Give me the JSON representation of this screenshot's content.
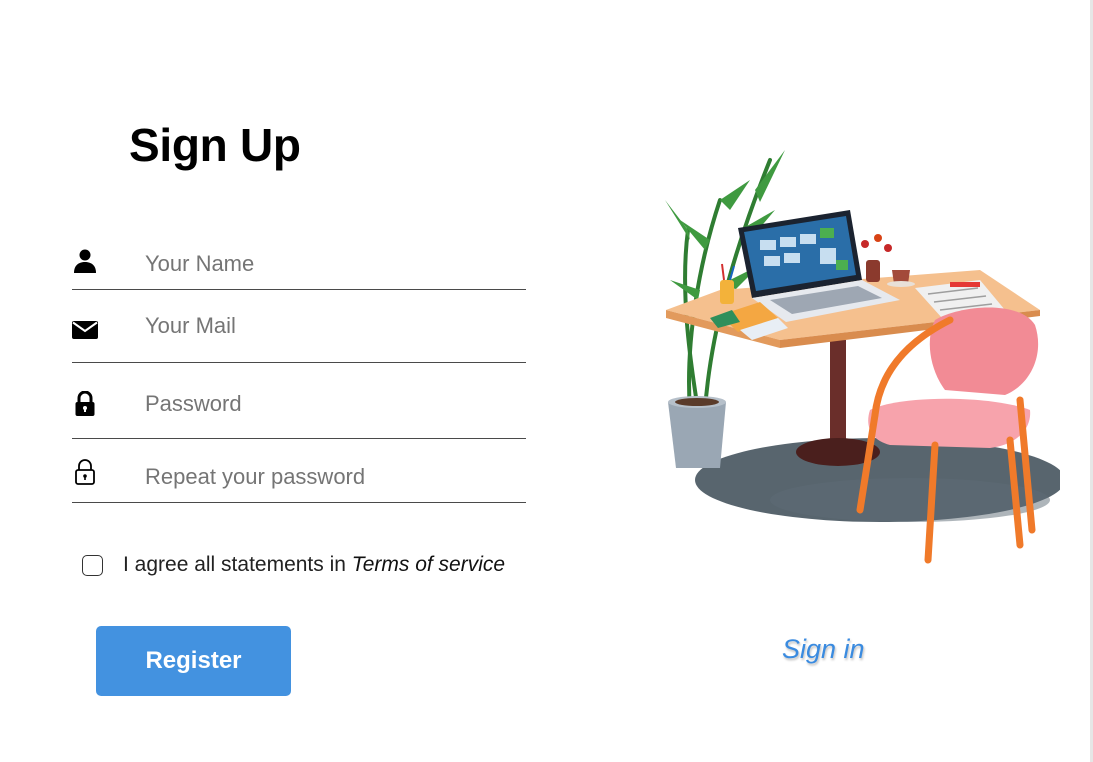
{
  "form": {
    "title": "Sign Up",
    "fields": {
      "name": {
        "placeholder": "Your Name",
        "value": "",
        "icon": "person-icon"
      },
      "mail": {
        "placeholder": "Your Mail",
        "value": "",
        "icon": "envelope-icon"
      },
      "password": {
        "placeholder": "Password",
        "value": "",
        "icon": "lock-icon"
      },
      "repeat_password": {
        "placeholder": "Repeat your password",
        "value": "",
        "icon": "lock-outline-icon"
      }
    },
    "agree": {
      "text": "I agree all statements in ",
      "terms_link": "Terms of service",
      "checked": false
    },
    "register_label": "Register"
  },
  "signin_link": "Sign in",
  "illustration": {
    "icon": "desk-workspace-illustration"
  },
  "colors": {
    "primary": "#4392e0",
    "link": "#3a8be0",
    "text": "#000000",
    "placeholder": "#757575"
  }
}
